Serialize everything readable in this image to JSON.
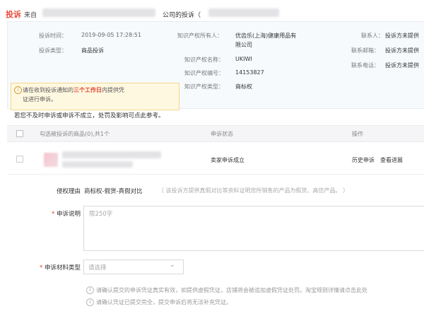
{
  "header": {
    "tag": "投诉",
    "from_prefix": "来自",
    "middle_text": "公司的投诉（"
  },
  "info": {
    "complaint_time_label": "投诉时间：",
    "complaint_time_value": "2019-09-05 17:28:51",
    "complaint_type_label": "投诉类型：",
    "complaint_type_value": "商品投诉",
    "owner_label": "知识产权所有人：",
    "owner_value_line1": "优齿乐(上海)健康用品有",
    "owner_value_line2": "限公司",
    "ip_name_label": "知识产权名称：",
    "ip_name_value": "UKIWI",
    "ip_number_label": "知识产权编号：",
    "ip_number_value": "14153827",
    "ip_type_label": "知识产权类型：",
    "ip_type_value": "商标权",
    "contact_label": "联系人：",
    "contact_value": "投诉方未提供",
    "email_label": "联系邮箱：",
    "email_value": "投诉方未提供",
    "phone_label": "联系电话：",
    "phone_value": "投诉方未提供"
  },
  "notice": {
    "pre": "请在收到投诉通知的",
    "highlight": "三个工作日",
    "post": "内提供凭",
    "line2": "证进行申诉。"
  },
  "pre_table_text": "若您不及时申诉或申诉不成立，处罚及影响可点此参考。",
  "table": {
    "header_goods": "勾选被投诉的商品(0),共1个",
    "header_status": "申诉状态",
    "header_action": "操作",
    "row_status": "卖家申诉成立",
    "row_action1": "历史申诉",
    "row_action2": "查看进展"
  },
  "form": {
    "reason_label": "侵权理由",
    "reason_value": "商标权-假货-真假对比",
    "reason_hint": "（ 该投诉方提供真假对比等资料证明您所销售的产品为假货、高仿产品。 ）",
    "desc_label": "申诉说明",
    "desc_placeholder": "限250字",
    "material_label": "申诉材料类型",
    "material_placeholder": "请选择",
    "hint1": "请确认提交的申诉凭证真实有效，如提供虚假凭证，店铺将会被追加虚假凭证处罚。淘宝规则详情请点击此处",
    "hint2": "请确认凭证已提交完全，提交申诉后将无法补充凭证。"
  }
}
